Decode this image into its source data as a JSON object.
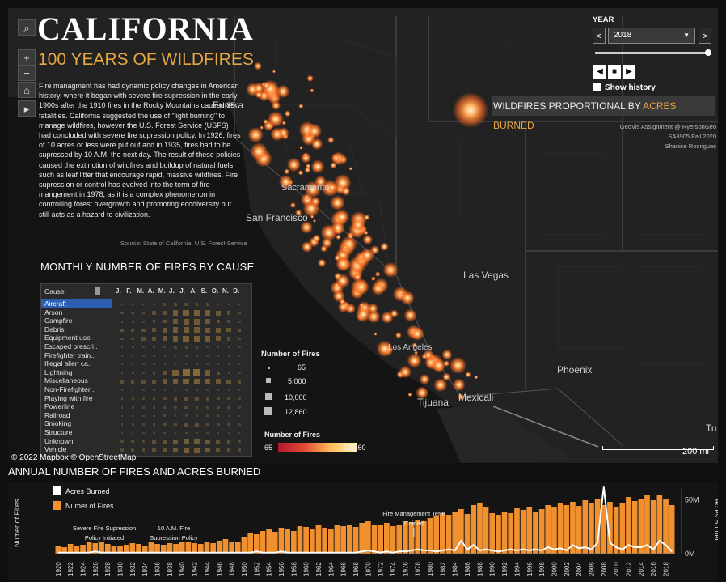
{
  "header": {
    "title": "CALIFORNIA",
    "subtitle": "100 YEARS OF WILDFIRES"
  },
  "description": {
    "text": "Fire managment has had dynamic policy changes in American history, where it began with severe fire supression in the early 1900s after the 1910 fires in the Rocky Mountains caused 85 fatalities. California suggested the use of \"light burning\" to manage wildfires, however the U.S. Forest Service (USFS) had concluded with severe fire supression policy. In 1926, fires of 10 acres or less were put out and in 1935, fires had to be supressed by 10 A.M. the next day. The result of these policies caused the extinction of wildfires and buildup of natural fuels such as leaf litter that encourage rapid, massive wildfires. Fire supression or control has evolved into the term of fire mangement in 1978, as it is a complex phenomenon in controlling forest overgrowth and promoting ecodiversity but still acts as a hazard to civilization.",
    "source": "Source: State of California, U.S. Forest Service"
  },
  "map_controls": {
    "search_icon": "search-icon",
    "zoom_in": "+",
    "zoom_out": "−",
    "home_icon": "home-icon",
    "expand_icon": "play-icon"
  },
  "year_filter": {
    "label": "YEAR",
    "selected": "2018",
    "prev": "<",
    "next": ">",
    "show_history": "Show history",
    "progress": 1.0
  },
  "map": {
    "legend_title": "WILDFIRES PROPORTIONAL BY",
    "legend_accent": "ACRES BURNED",
    "credit": [
      "GeoVis Assignment @ RyersonGeo",
      "SA8905 Fall 2020",
      "Shanice Rodrigues"
    ],
    "cities": [
      "Eureka",
      "Sacramento",
      "San Francisco",
      "Las Vegas",
      "Los Angeles",
      "Phoenix",
      "Tijuana",
      "Mexicali",
      "Tu"
    ],
    "attribution": "© 2022 Mapbox  © OpenStreetMap",
    "scale": "200 mi",
    "size_legend": {
      "title": "Number of Fires",
      "items": [
        "65",
        "5,000",
        "10,000",
        "12,860"
      ]
    },
    "color_legend": {
      "title": "Number of Fires",
      "min": "65",
      "max": "12,860"
    },
    "colors": {
      "glow": "#ff8c3a",
      "core": "#ffd9a0",
      "accent": "#e6a640"
    }
  },
  "monthly": {
    "title": "MONTHLY NUMBER OF FIRES BY CAUSE",
    "column_header": "Cause",
    "months": [
      "J.",
      "F.",
      "M.",
      "A.",
      "M.",
      "J.",
      "J.",
      "A.",
      "S.",
      "O.",
      "N.",
      "D."
    ],
    "selected": "Aircraft",
    "causes": [
      "Aircraft",
      "Arson",
      "Campfire",
      "Debris",
      "Equipment use",
      "Escaped prescri..",
      "Firefighter train..",
      "Illegal alien ca..",
      "Lightning",
      "Miscellaneous",
      "Non-Firefighter ..",
      "Playing with fire",
      "Powerline",
      "Railroad",
      "Smoking",
      "Structure",
      "Unknown",
      "Vehicle"
    ],
    "intensity": [
      [
        0.1,
        0.1,
        0.1,
        0.1,
        0.15,
        0.2,
        0.2,
        0.2,
        0.15,
        0.1,
        0.1,
        0.1
      ],
      [
        0.2,
        0.2,
        0.2,
        0.3,
        0.4,
        0.6,
        0.7,
        0.7,
        0.6,
        0.5,
        0.3,
        0.2
      ],
      [
        0.1,
        0.1,
        0.1,
        0.2,
        0.3,
        0.5,
        0.6,
        0.6,
        0.5,
        0.3,
        0.2,
        0.1
      ],
      [
        0.3,
        0.3,
        0.3,
        0.4,
        0.5,
        0.6,
        0.6,
        0.6,
        0.5,
        0.5,
        0.4,
        0.3
      ],
      [
        0.2,
        0.2,
        0.3,
        0.4,
        0.5,
        0.6,
        0.7,
        0.7,
        0.6,
        0.5,
        0.3,
        0.2
      ],
      [
        0.1,
        0.1,
        0.1,
        0.1,
        0.1,
        0.15,
        0.15,
        0.15,
        0.1,
        0.1,
        0.1,
        0.1
      ],
      [
        0.05,
        0.05,
        0.05,
        0.05,
        0.05,
        0.1,
        0.1,
        0.1,
        0.05,
        0.05,
        0.05,
        0.05
      ],
      [
        0.05,
        0.05,
        0.05,
        0.05,
        0.05,
        0.05,
        0.05,
        0.05,
        0.05,
        0.05,
        0.05,
        0.05
      ],
      [
        0.1,
        0.1,
        0.1,
        0.2,
        0.4,
        0.7,
        0.9,
        0.9,
        0.6,
        0.3,
        0.1,
        0.1
      ],
      [
        0.3,
        0.3,
        0.3,
        0.4,
        0.5,
        0.6,
        0.7,
        0.7,
        0.6,
        0.5,
        0.4,
        0.3
      ],
      [
        0.05,
        0.05,
        0.05,
        0.05,
        0.05,
        0.1,
        0.1,
        0.1,
        0.05,
        0.05,
        0.05,
        0.05
      ],
      [
        0.1,
        0.1,
        0.1,
        0.15,
        0.2,
        0.3,
        0.3,
        0.3,
        0.25,
        0.2,
        0.15,
        0.1
      ],
      [
        0.1,
        0.1,
        0.1,
        0.1,
        0.15,
        0.2,
        0.2,
        0.2,
        0.2,
        0.2,
        0.15,
        0.1
      ],
      [
        0.05,
        0.05,
        0.05,
        0.05,
        0.1,
        0.1,
        0.1,
        0.1,
        0.1,
        0.1,
        0.05,
        0.05
      ],
      [
        0.1,
        0.1,
        0.1,
        0.15,
        0.2,
        0.25,
        0.3,
        0.3,
        0.25,
        0.2,
        0.15,
        0.1
      ],
      [
        0.05,
        0.05,
        0.05,
        0.05,
        0.1,
        0.1,
        0.1,
        0.1,
        0.1,
        0.1,
        0.05,
        0.05
      ],
      [
        0.2,
        0.2,
        0.2,
        0.3,
        0.4,
        0.5,
        0.6,
        0.6,
        0.5,
        0.4,
        0.3,
        0.2
      ],
      [
        0.2,
        0.2,
        0.2,
        0.3,
        0.4,
        0.5,
        0.6,
        0.6,
        0.5,
        0.4,
        0.3,
        0.2
      ]
    ]
  },
  "annual": {
    "title": "ANNUAL NUMBER OF FIRES AND ACRES BURNED",
    "legend": [
      "Acres Burned",
      "Numer of Fires"
    ],
    "y_left_label": "Numer of Fires",
    "y_right_label": "Acres Burned",
    "y_right_ticks": [
      "50M",
      "0M"
    ],
    "annotations": [
      "Severe Fire Supression Policy Initiated",
      "10 A.M. Fire Supression Policy",
      "Fire Management Term Coined"
    ],
    "colors": {
      "bar": "#f0902f",
      "line": "#ffffff"
    }
  },
  "chart_data": {
    "type": "bar",
    "title": "ANNUAL NUMBER OF FIRES AND ACRES BURNED",
    "x": [
      1920,
      1921,
      1922,
      1923,
      1924,
      1925,
      1926,
      1927,
      1928,
      1929,
      1930,
      1931,
      1932,
      1933,
      1934,
      1935,
      1936,
      1937,
      1938,
      1939,
      1940,
      1941,
      1942,
      1943,
      1944,
      1945,
      1946,
      1947,
      1948,
      1949,
      1950,
      1951,
      1952,
      1953,
      1954,
      1955,
      1956,
      1957,
      1958,
      1959,
      1960,
      1961,
      1962,
      1963,
      1964,
      1965,
      1966,
      1967,
      1968,
      1969,
      1970,
      1971,
      1972,
      1973,
      1974,
      1975,
      1976,
      1977,
      1978,
      1979,
      1980,
      1981,
      1982,
      1983,
      1984,
      1985,
      1986,
      1987,
      1988,
      1989,
      1990,
      1991,
      1992,
      1993,
      1994,
      1995,
      1996,
      1997,
      1998,
      1999,
      2000,
      2001,
      2002,
      2003,
      2004,
      2005,
      2006,
      2007,
      2008,
      2009,
      2010,
      2011,
      2012,
      2013,
      2014,
      2015,
      2016,
      2017,
      2018,
      2019
    ],
    "x_tick_labels": [
      "1920",
      "1922",
      "1924",
      "1926",
      "1928",
      "1930",
      "1932",
      "1934",
      "1936",
      "1938",
      "1940",
      "1942",
      "1944",
      "1946",
      "1948",
      "1950",
      "1952",
      "1954",
      "1956",
      "1958",
      "1960",
      "1962",
      "1964",
      "1966",
      "1968",
      "1970",
      "1972",
      "1974",
      "1976",
      "1978",
      "1980",
      "1982",
      "1984",
      "1986",
      "1988",
      "1990",
      "1992",
      "1994",
      "1996",
      "1998",
      "2000",
      "2002",
      "2004",
      "2006",
      "2008",
      "2010",
      "2012",
      "2014",
      "2016",
      "2018"
    ],
    "series": [
      {
        "name": "Numer of Fires",
        "type": "bar",
        "values": [
          10,
          8,
          12,
          9,
          11,
          14,
          13,
          15,
          12,
          10,
          9,
          11,
          13,
          12,
          10,
          14,
          12,
          11,
          13,
          12,
          15,
          14,
          13,
          12,
          14,
          13,
          16,
          18,
          15,
          14,
          20,
          26,
          24,
          28,
          30,
          27,
          32,
          30,
          28,
          34,
          33,
          30,
          36,
          32,
          30,
          35,
          34,
          36,
          33,
          38,
          40,
          36,
          35,
          38,
          34,
          36,
          40,
          39,
          42,
          40,
          44,
          46,
          50,
          48,
          52,
          55,
          49,
          60,
          62,
          58,
          50,
          48,
          52,
          50,
          56,
          54,
          58,
          52,
          55,
          60,
          58,
          62,
          60,
          64,
          59,
          66,
          62,
          68,
          60,
          64,
          58,
          62,
          70,
          65,
          68,
          72,
          66,
          72,
          68,
          60
        ]
      },
      {
        "name": "Acres Burned",
        "type": "line",
        "values": [
          1,
          1,
          1,
          1,
          1,
          1,
          2,
          1,
          1,
          1,
          1,
          1,
          1,
          1,
          1,
          1,
          1,
          1,
          1,
          1,
          1,
          1,
          1,
          1,
          1,
          1,
          1,
          1,
          1,
          1,
          1,
          1,
          2,
          1,
          1,
          1,
          2,
          1,
          1,
          1,
          1,
          1,
          1,
          1,
          1,
          1,
          1,
          1,
          1,
          2,
          3,
          2,
          1,
          2,
          1,
          2,
          2,
          3,
          4,
          3,
          3,
          2,
          3,
          4,
          3,
          12,
          4,
          8,
          3,
          4,
          3,
          2,
          3,
          4,
          3,
          4,
          3,
          4,
          3,
          6,
          4,
          5,
          3,
          8,
          5,
          6,
          4,
          10,
          62,
          10,
          6,
          4,
          8,
          6,
          6,
          8,
          4,
          12,
          8,
          2
        ]
      }
    ],
    "ylabel": "Numer of Fires",
    "y2label": "Acres Burned",
    "y2lim": [
      0,
      60
    ],
    "legend": "top-left"
  }
}
